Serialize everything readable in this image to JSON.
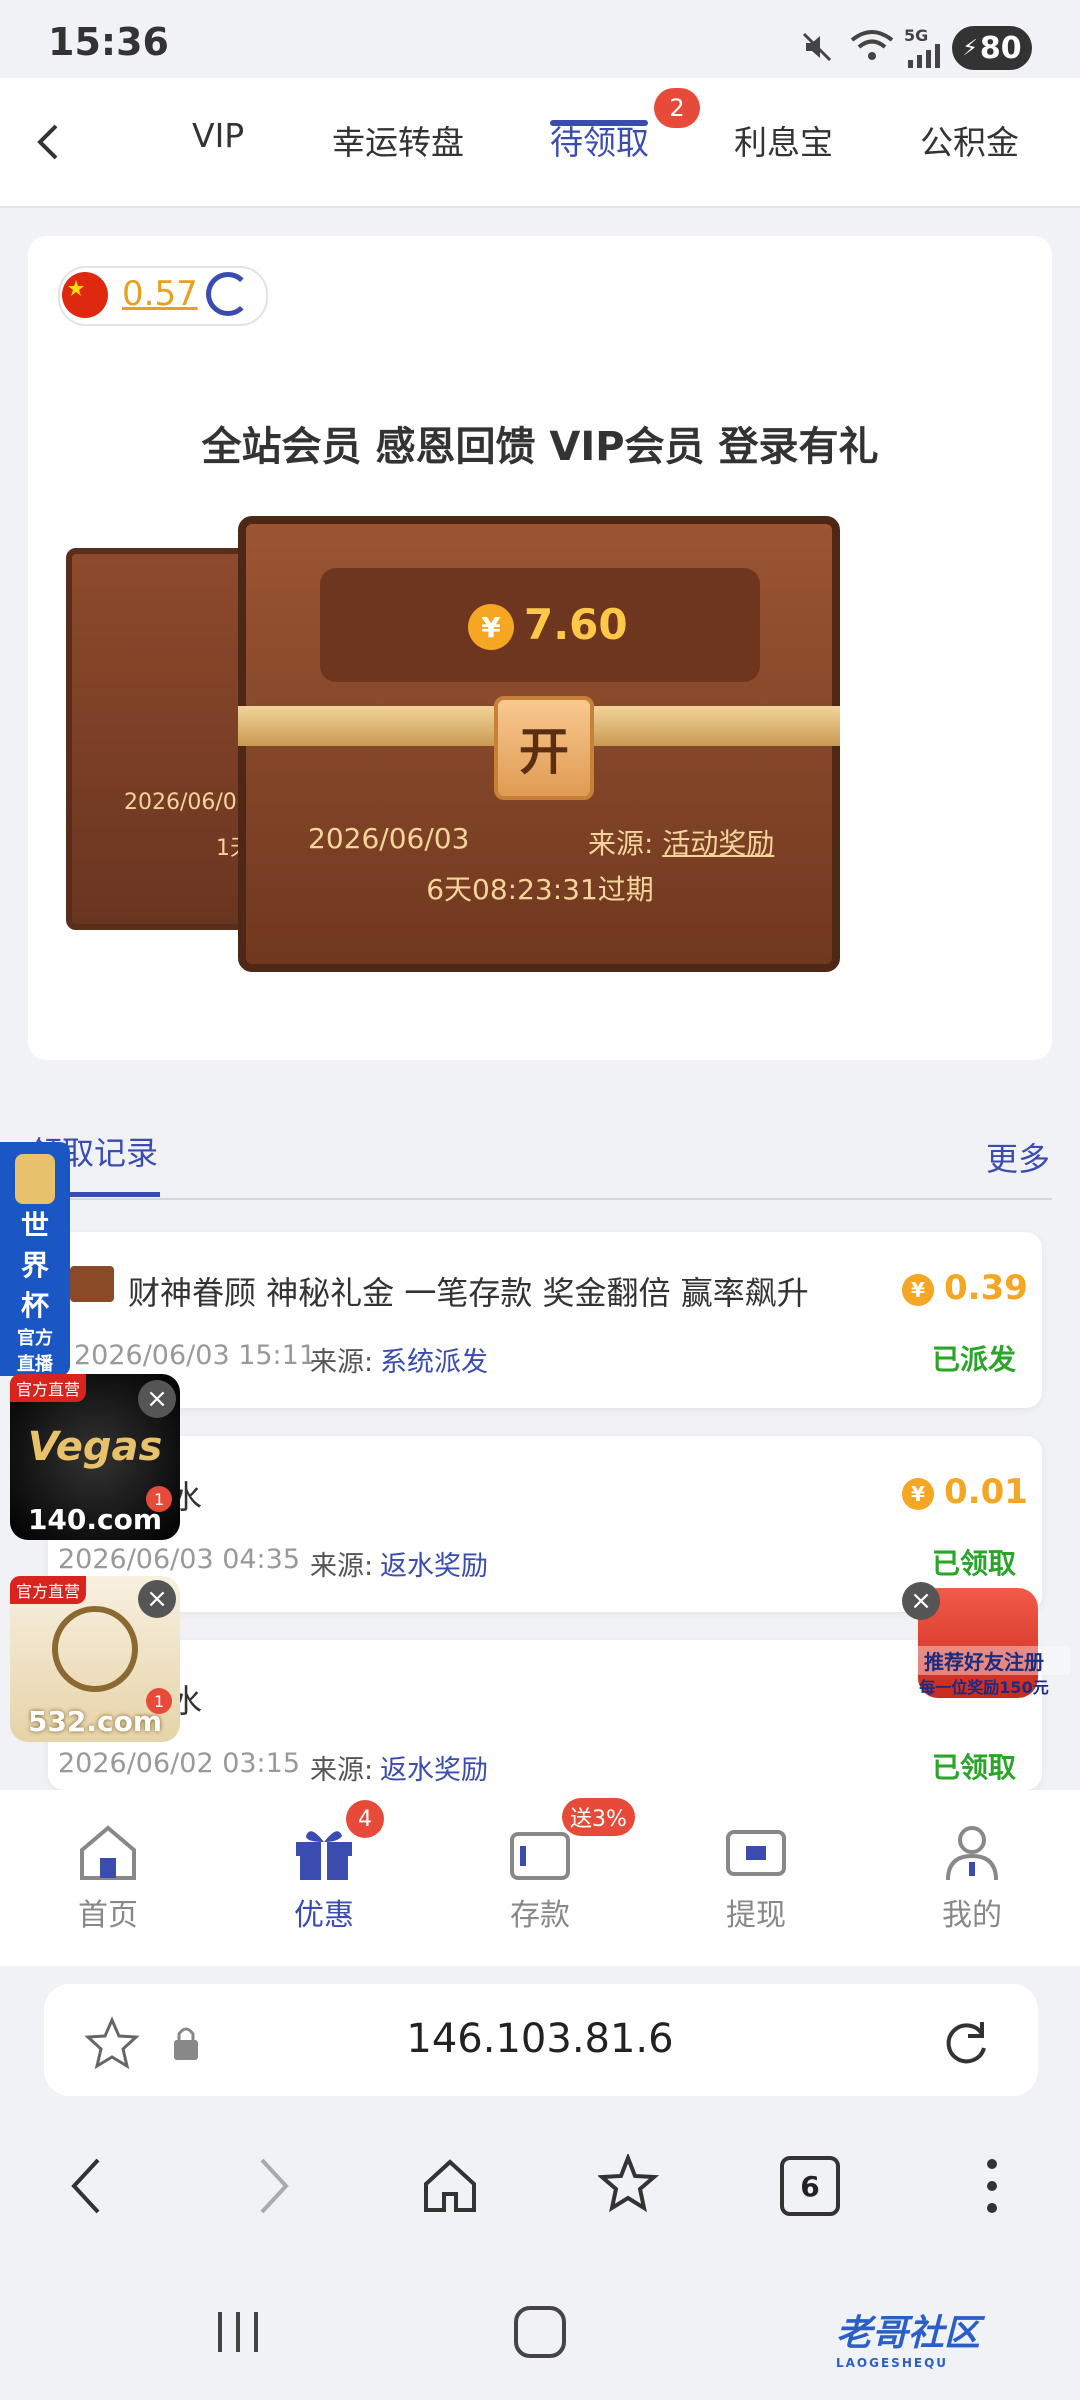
{
  "status_bar": {
    "time": "15:36",
    "battery": "80",
    "network": "5G"
  },
  "tabs": [
    {
      "label": "VIP"
    },
    {
      "label": "幸运转盘"
    },
    {
      "label": "待领取",
      "badge": "2",
      "active": true
    },
    {
      "label": "利息宝"
    },
    {
      "label": "公积金"
    }
  ],
  "balance": {
    "amount": "0.57"
  },
  "promo": {
    "headline": "全站会员 感恩回馈 VIP会员 登录有礼",
    "chest_amount": "7.60",
    "open_label": "开",
    "date": "2026/06/03",
    "source_label": "来源:",
    "source": "活动奖励",
    "expire": "6天08:23:31过期",
    "back_chest_date": "2026/06/03",
    "back_chest_partial": "1天"
  },
  "records": {
    "title": "领取记录",
    "more": "更多",
    "items": [
      {
        "name": "财神眷顾 神秘礼金 一笔存款 奖金翻倍 赢率飙升",
        "amount": "0.39",
        "datetime": "2026/06/03 15:11",
        "source_label": "来源:",
        "source": "系统派发",
        "status": "已派发"
      },
      {
        "name": "水",
        "amount": "0.01",
        "datetime": "2026/06/03 04:35",
        "source_label": "来源:",
        "source": "返水奖励",
        "status": "已领取"
      },
      {
        "name": "水",
        "amount": "",
        "datetime": "2026/06/02 03:15",
        "source_label": "来源:",
        "source": "返水奖励",
        "status": "已领取"
      }
    ]
  },
  "ads": {
    "worldcup": [
      "世",
      "界",
      "杯",
      "官方",
      "直播"
    ],
    "vegas": {
      "tag": "官方直营",
      "brand": "Vegas",
      "site": "140.com",
      "badge": "1"
    },
    "site532": {
      "tag": "官方直营",
      "site": "532.com",
      "badge": "1"
    },
    "referral": {
      "line1": "推荐好友注册",
      "line2": "每一位奖励150元"
    }
  },
  "bottom_nav": [
    {
      "label": "首页"
    },
    {
      "label": "优惠",
      "badge": "4",
      "active": true
    },
    {
      "label": "存款",
      "badge": "送3%"
    },
    {
      "label": "提现"
    },
    {
      "label": "我的"
    }
  ],
  "browser": {
    "url": "146.103.81.6",
    "tab_count": "6"
  },
  "watermark": {
    "text": "老哥社区",
    "sub": "LAOGESHEQU"
  },
  "colors": {
    "accent": "#3a4cb0",
    "gold": "#f5a623",
    "success": "#2aa52a",
    "badge": "#e84a3a"
  }
}
